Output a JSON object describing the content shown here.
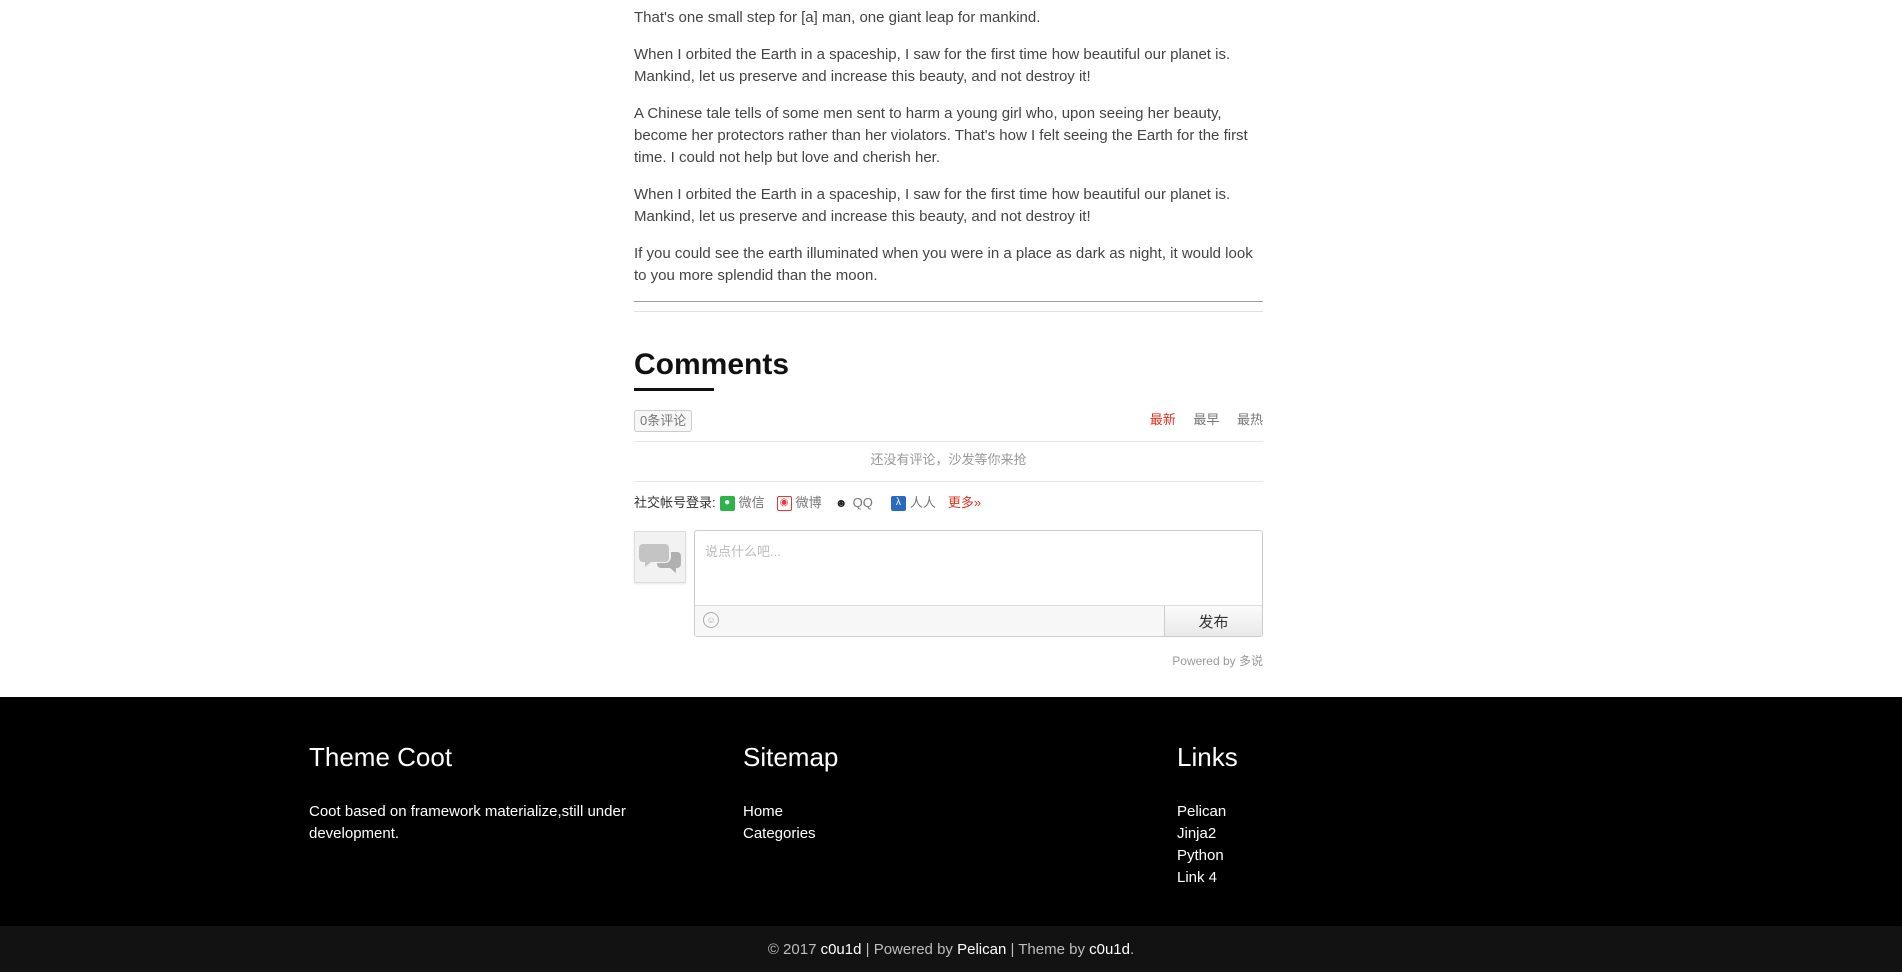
{
  "article": {
    "paragraphs": [
      "That's one small step for [a] man, one giant leap for mankind.",
      "When I orbited the Earth in a spaceship, I saw for the first time how beautiful our planet is. Mankind, let us preserve and increase this beauty, and not destroy it!",
      "A Chinese tale tells of some men sent to harm a young girl who, upon seeing her beauty, become her protectors rather than her violators. That's how I felt seeing the Earth for the first time. I could not help but love and cherish her.",
      "When I orbited the Earth in a spaceship, I saw for the first time how beautiful our planet is. Mankind, let us preserve and increase this beauty, and not destroy it!",
      "If you could see the earth illuminated when you were in a place as dark as night, it would look to you more splendid than the moon."
    ]
  },
  "comments": {
    "title": "Comments",
    "count_label": "0条评论",
    "sort_tabs": [
      {
        "label": "最新",
        "active": true
      },
      {
        "label": "最早",
        "active": false
      },
      {
        "label": "最热",
        "active": false
      }
    ],
    "empty_message": "还没有评论，沙发等你来抢",
    "social_login": {
      "label": "社交帐号登录:",
      "providers": [
        {
          "label": "微信",
          "icon": "wechat-icon"
        },
        {
          "label": "微博",
          "icon": "weibo-icon"
        },
        {
          "label": "QQ",
          "icon": "qq-icon"
        },
        {
          "label": "人人",
          "icon": "renren-icon"
        }
      ],
      "more_label": "更多»"
    },
    "input_placeholder": "说点什么吧...",
    "submit_label": "发布",
    "powered_by": "Powered by 多说"
  },
  "footer": {
    "about": {
      "title": "Theme Coot",
      "text": "Coot based on framework materialize,still under development."
    },
    "sitemap": {
      "title": "Sitemap",
      "links": [
        "Home",
        "Categories"
      ]
    },
    "links": {
      "title": "Links",
      "items": [
        "Pelican",
        "Jinja2",
        "Python",
        "Link 4"
      ]
    },
    "copyright": {
      "prefix": "© 2017 ",
      "author": "c0u1d",
      "powered_text": " | Powered by ",
      "powered_link": "Pelican",
      "theme_text": " | Theme by ",
      "theme_link": "c0u1d",
      "suffix": "."
    }
  },
  "colors": {
    "accent_red": "#dd3322",
    "footer_bg": "#000000",
    "footer_bottom_bg": "#121212"
  }
}
